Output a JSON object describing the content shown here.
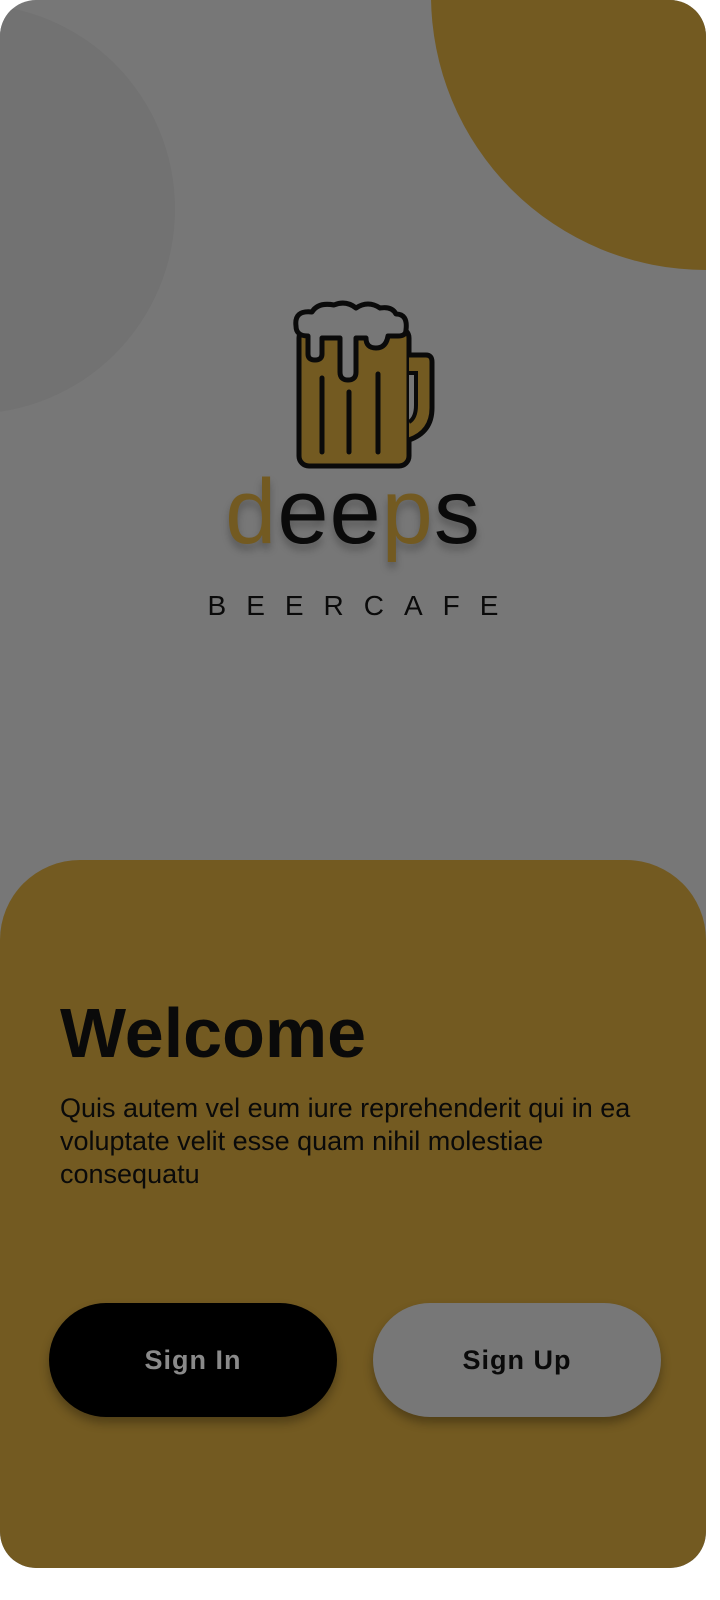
{
  "brand": {
    "name_prefix": "d",
    "name_middle": "ee",
    "name_p": "p",
    "name_suffix": "s",
    "tagline": "BEERCAFE",
    "logo_icon": "beer-mug-icon"
  },
  "welcome": {
    "title": "Welcome",
    "body": "Quis autem vel eum iure reprehenderit qui in ea voluptate velit esse quam nihil molestiae consequatu"
  },
  "actions": {
    "sign_in_label": "Sign In",
    "sign_up_label": "Sign Up"
  },
  "colors": {
    "background": "#777777",
    "accent": "#735a21",
    "text": "#0a0a0a",
    "primary_button": "#000000"
  }
}
